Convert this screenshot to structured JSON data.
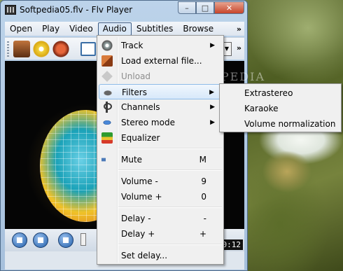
{
  "window": {
    "title": "Softpedia05.flv - Flv Player",
    "caption_buttons": {
      "minimize": "–",
      "maximize": "□",
      "close": "✕"
    }
  },
  "menubar": {
    "items": [
      "Open",
      "Play",
      "Video",
      "Audio",
      "Subtitles",
      "Browse"
    ],
    "more": "»",
    "active": "Audio"
  },
  "toolbar": {
    "more": "»",
    "dropdown": "▼"
  },
  "video": {
    "watermark": "SOFTPEDIA"
  },
  "controls": {
    "time": "00:12"
  },
  "audio_menu": {
    "items": [
      {
        "label": "Track",
        "icon": "speaker-disc-icon",
        "shortcut": "",
        "submenu": true,
        "disabled": false
      },
      {
        "label": "Load external file...",
        "icon": "load-file-icon",
        "shortcut": "",
        "submenu": false,
        "disabled": false
      },
      {
        "label": "Unload",
        "icon": "unload-icon",
        "shortcut": "",
        "submenu": false,
        "disabled": true
      },
      {
        "label": "Filters",
        "icon": "filters-icon",
        "shortcut": "",
        "submenu": true,
        "disabled": false,
        "highlighted": true
      },
      {
        "label": "Channels",
        "icon": "channels-icon",
        "shortcut": "",
        "submenu": true,
        "disabled": false
      },
      {
        "label": "Stereo mode",
        "icon": "stereo-mode-icon",
        "shortcut": "",
        "submenu": true,
        "disabled": false
      },
      {
        "label": "Equalizer",
        "icon": "equalizer-icon",
        "shortcut": "",
        "submenu": false,
        "disabled": false
      },
      {
        "label": "Mute",
        "icon": "mute-icon",
        "shortcut": "M",
        "submenu": false,
        "disabled": false
      },
      {
        "label": "Volume -",
        "icon": "",
        "shortcut": "9",
        "submenu": false,
        "disabled": false
      },
      {
        "label": "Volume +",
        "icon": "",
        "shortcut": "0",
        "submenu": false,
        "disabled": false
      },
      {
        "label": "Delay -",
        "icon": "",
        "shortcut": "-",
        "submenu": false,
        "disabled": false
      },
      {
        "label": "Delay +",
        "icon": "",
        "shortcut": "+",
        "submenu": false,
        "disabled": false
      },
      {
        "label": "Set delay...",
        "icon": "",
        "shortcut": "",
        "submenu": false,
        "disabled": false
      }
    ],
    "submenu_arrow": "▶"
  },
  "filters_submenu": {
    "items": [
      "Extrastereo",
      "Karaoke",
      "Volume normalization"
    ]
  }
}
